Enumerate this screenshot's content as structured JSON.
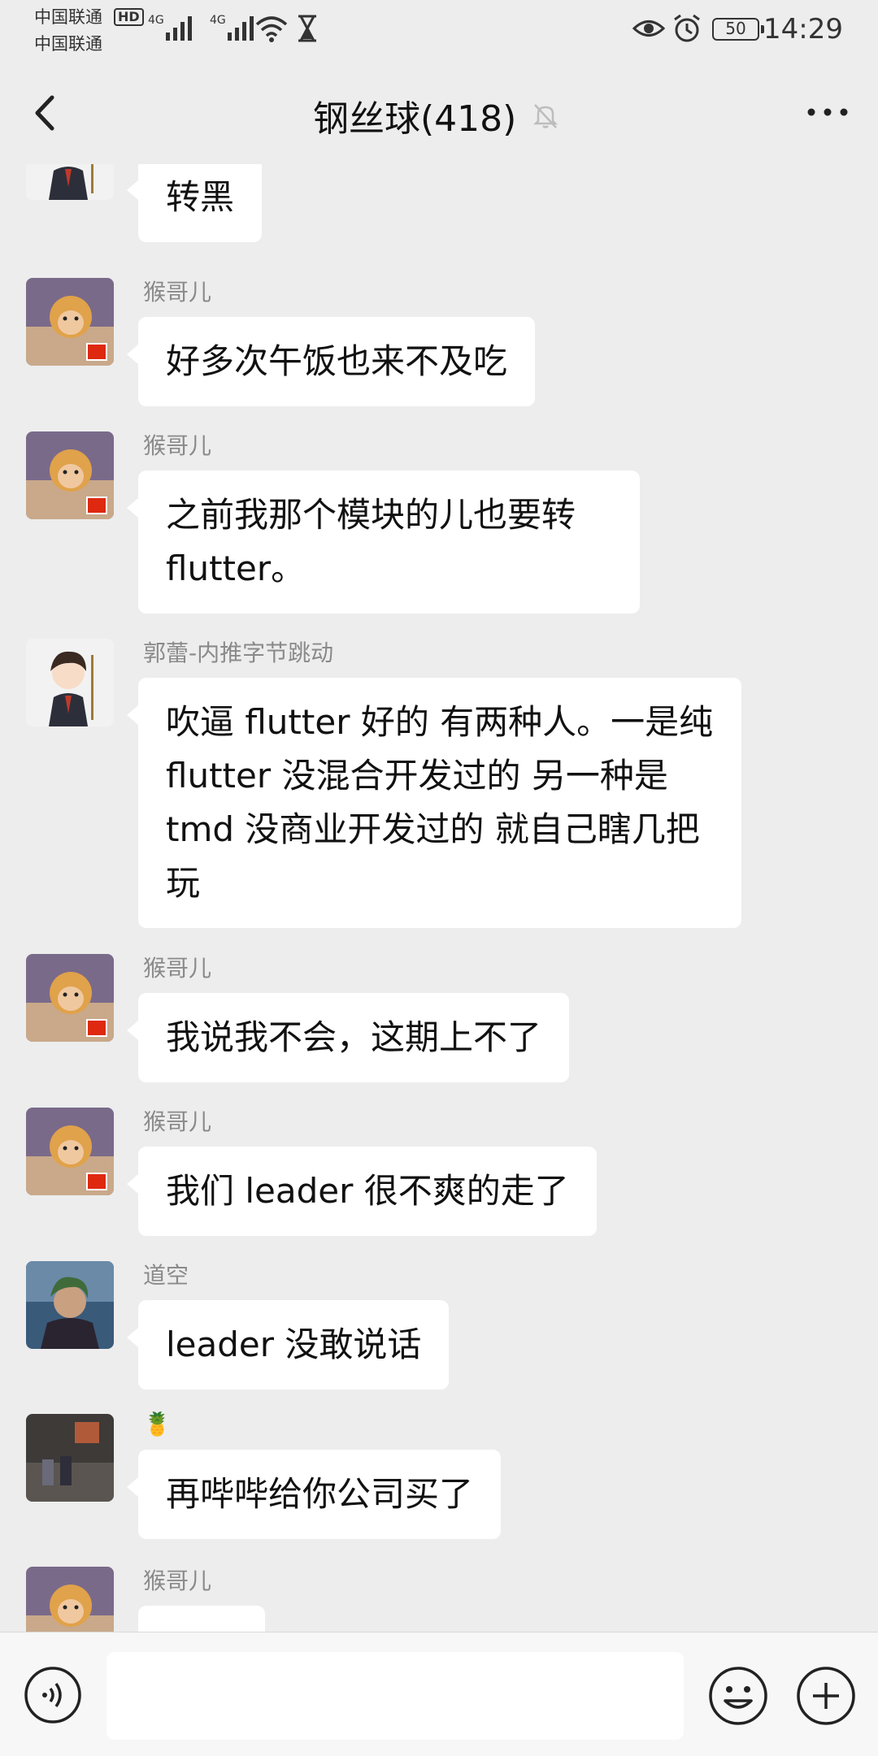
{
  "status": {
    "carrier1": "中国联通",
    "carrier2": "中国联通",
    "hd": "HD",
    "net1": "4G",
    "net2": "4G",
    "battery": "50",
    "time": "14:29"
  },
  "header": {
    "title": "钢丝球(418)"
  },
  "messages": [
    {
      "sender": "",
      "text": "转黑",
      "avatar": "cartoon-boy-avatar"
    },
    {
      "sender": "猴哥儿",
      "text": "好多次午饭也来不及吃",
      "avatar": "monkey-king-avatar"
    },
    {
      "sender": "猴哥儿",
      "text": "之前我那个模块的儿也要转 flutter。",
      "avatar": "monkey-king-avatar"
    },
    {
      "sender": "郭蕾-内推字节跳动",
      "text": "吹逼 flutter 好的 有两种人。一是纯 flutter 没混合开发过的 另一种是 tmd 没商业开发过的 就自己瞎几把玩",
      "avatar": "cartoon-boy-avatar"
    },
    {
      "sender": "猴哥儿",
      "text": "我说我不会，这期上不了",
      "avatar": "monkey-king-avatar"
    },
    {
      "sender": "猴哥儿",
      "text": "我们 leader 很不爽的走了",
      "avatar": "monkey-king-avatar"
    },
    {
      "sender": "道空",
      "text": "leader 没敢说话",
      "avatar": "anime-character-avatar"
    },
    {
      "sender": "🍍",
      "text": "再哔哔给你公司买了",
      "avatar": "street-photo-avatar"
    },
    {
      "sender": "猴哥儿",
      "text": "",
      "avatar": "monkey-king-avatar"
    }
  ],
  "input": {
    "placeholder": ""
  },
  "colors": {
    "background": "#ededed",
    "bubble": "#ffffff",
    "sender": "#8a8a8a"
  }
}
